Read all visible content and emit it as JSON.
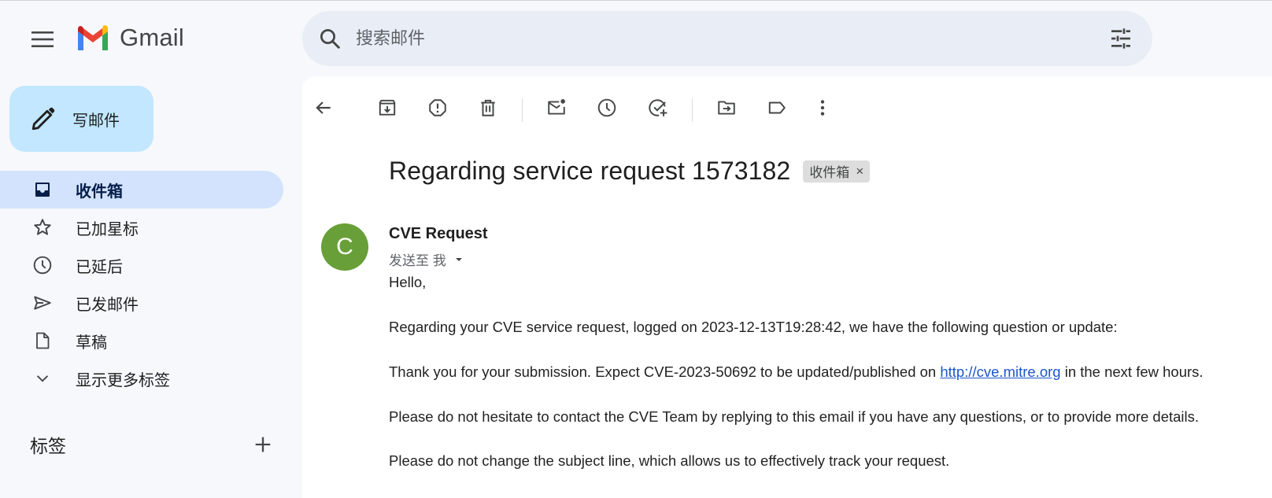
{
  "header": {
    "app_name": "Gmail",
    "search_placeholder": "搜索邮件",
    "icons": [
      "menu-icon",
      "gmail-logo-icon",
      "search-icon",
      "tune-icon"
    ]
  },
  "sidebar": {
    "compose_label": "写邮件",
    "items": [
      {
        "label": "收件箱",
        "icon": "inbox-icon",
        "active": true
      },
      {
        "label": "已加星标",
        "icon": "star-icon",
        "active": false
      },
      {
        "label": "已延后",
        "icon": "clock-icon",
        "active": false
      },
      {
        "label": "已发邮件",
        "icon": "send-icon",
        "active": false
      },
      {
        "label": "草稿",
        "icon": "draft-icon",
        "active": false
      },
      {
        "label": "显示更多标签",
        "icon": "chevron-down-icon",
        "active": false
      }
    ],
    "labels_header": "标签"
  },
  "toolbar": {
    "buttons": [
      "back-icon",
      "archive-icon",
      "report-spam-icon",
      "delete-icon",
      "mark-unread-icon",
      "snooze-icon",
      "add-task-icon",
      "move-to-icon",
      "label-icon",
      "more-icon"
    ]
  },
  "email": {
    "subject": "Regarding service request 1573182",
    "label_chip": "收件箱",
    "chip_close": "×",
    "sender_initial": "C",
    "sender_name": "CVE Request",
    "to_line": "发送至 我",
    "greeting": "Hello,",
    "para1": "Regarding your CVE service request, logged on 2023-12-13T19:28:42, we have the following question or update:",
    "para2_before": "Thank you for your submission. Expect CVE-2023-50692 to be updated/published on ",
    "para2_link": "http://cve.mitre.org",
    "para2_after": " in the next few hours.",
    "para3": "Please do not hesitate to contact the CVE Team by replying to this email if you have any questions, or to provide more details.",
    "para4": "Please do not change the subject line, which allows us to effectively track your request.",
    "colors": {
      "avatar": "#689f38",
      "link": "#1a56c9",
      "active_nav": "#d3e3fd",
      "compose": "#c2e7ff"
    }
  }
}
